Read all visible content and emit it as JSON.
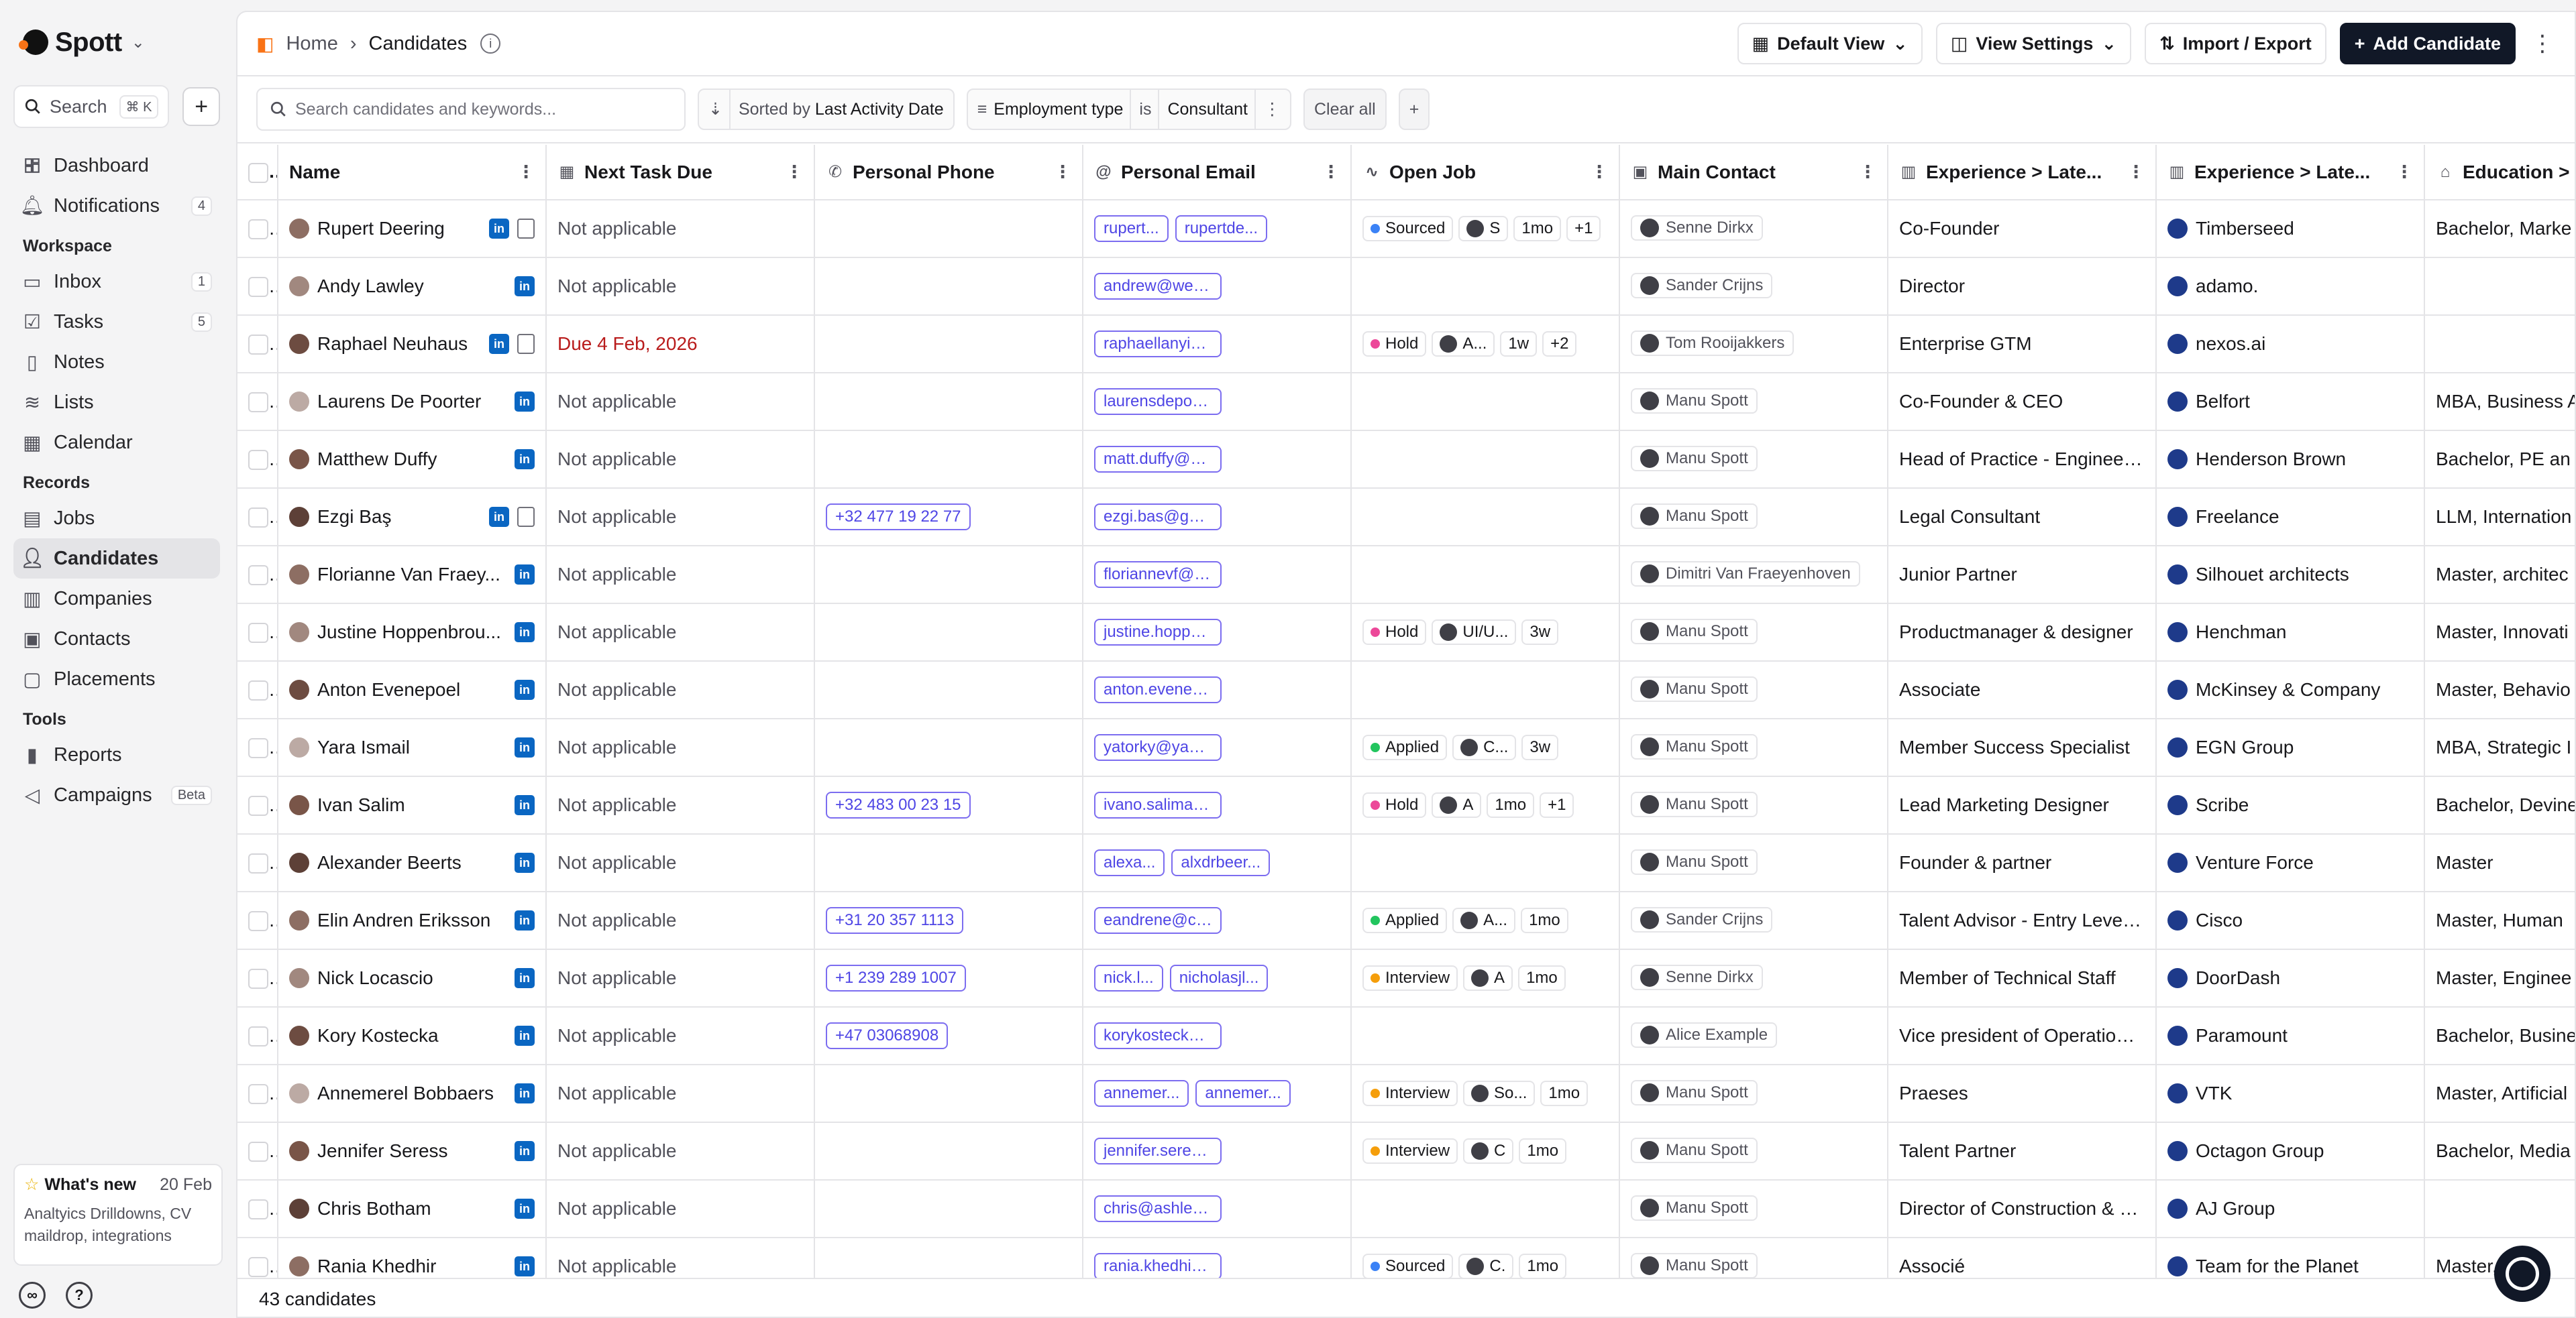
{
  "app": {
    "name": "Spott"
  },
  "sidebar": {
    "search_label": "Search",
    "search_shortcut": "⌘ K",
    "top_items": [
      {
        "label": "Dashboard",
        "icon": "dashboard-icon"
      },
      {
        "label": "Notifications",
        "icon": "bell-icon",
        "count": "4"
      }
    ],
    "workspace_title": "Workspace",
    "workspace_items": [
      {
        "label": "Inbox",
        "icon": "inbox-icon",
        "count": "1"
      },
      {
        "label": "Tasks",
        "icon": "tasks-icon",
        "count": "5"
      },
      {
        "label": "Notes",
        "icon": "notes-icon"
      },
      {
        "label": "Lists",
        "icon": "lists-icon"
      },
      {
        "label": "Calendar",
        "icon": "calendar-icon"
      }
    ],
    "records_title": "Records",
    "records_items": [
      {
        "label": "Jobs",
        "icon": "jobs-icon"
      },
      {
        "label": "Candidates",
        "icon": "user-icon",
        "active": true
      },
      {
        "label": "Companies",
        "icon": "building-icon"
      },
      {
        "label": "Contacts",
        "icon": "contacts-icon"
      },
      {
        "label": "Placements",
        "icon": "placements-icon"
      }
    ],
    "tools_title": "Tools",
    "tools_items": [
      {
        "label": "Reports",
        "icon": "reports-icon"
      },
      {
        "label": "Campaigns",
        "icon": "megaphone-icon",
        "badge": "Beta"
      }
    ],
    "whats_new": {
      "title": "What's new",
      "date": "20 Feb",
      "body": "Analtyics Drilldowns, CV maildrop, integrations"
    }
  },
  "topbar": {
    "home": "Home",
    "current": "Candidates",
    "default_view": "Default View",
    "view_settings": "View Settings",
    "import_export": "Import / Export",
    "add_candidate": "Add Candidate"
  },
  "filters": {
    "search_placeholder": "Search candidates and keywords...",
    "sort_prefix": "Sorted by",
    "sort_value": "Last Activity Date",
    "filter_field": "Employment type",
    "filter_op": "is",
    "filter_value": "Consultant",
    "clear_all": "Clear all"
  },
  "table": {
    "columns": [
      {
        "label": "Name",
        "icon": "text-icon"
      },
      {
        "label": "Next Task Due",
        "icon": "calendar-icon"
      },
      {
        "label": "Personal Phone",
        "icon": "phone-icon"
      },
      {
        "label": "Personal Email",
        "icon": "at-icon"
      },
      {
        "label": "Open Job",
        "icon": "activity-icon"
      },
      {
        "label": "Main Contact",
        "icon": "contact-icon"
      },
      {
        "label": "Experience > Late...",
        "icon": "building-icon"
      },
      {
        "label": "Experience > Late...",
        "icon": "building-icon"
      },
      {
        "label": "Education >",
        "icon": "graduation-icon"
      }
    ],
    "rows": [
      {
        "name": "Rupert Deering",
        "cv": true,
        "task": "Not applicable",
        "phone": "",
        "emails": [
          "rupert...",
          "rupertde..."
        ],
        "job": {
          "status": "Sourced",
          "color": "#3b82f6",
          "company": "S",
          "time": "1mo",
          "extra": "+1"
        },
        "contact": "Senne Dirkx",
        "title": "Co-Founder",
        "company": "Timberseed",
        "education": "Bachelor, Marke"
      },
      {
        "name": "Andy Lawley",
        "cv": false,
        "task": "Not applicable",
        "phone": "",
        "emails": [
          "andrew@weareadamo.com"
        ],
        "job": null,
        "contact": "Sander Crijns",
        "title": "Director",
        "company": "adamo.",
        "education": ""
      },
      {
        "name": "Raphael Neuhaus",
        "cv": true,
        "task": "Due 4 Feb, 2026",
        "task_due": true,
        "phone": "",
        "emails": [
          "raphaellanyi@gmail.com"
        ],
        "job": {
          "status": "Hold",
          "color": "#ec4899",
          "company": "A...",
          "time": "1w",
          "extra": "+2"
        },
        "contact": "Tom Rooijakkers",
        "title": "Enterprise GTM",
        "company": "nexos.ai",
        "education": ""
      },
      {
        "name": "Laurens De Poorter",
        "cv": false,
        "task": "Not applicable",
        "phone": "",
        "emails": [
          "laurensdepoorter@gmail.com"
        ],
        "job": null,
        "contact": "Manu Spott",
        "title": "Co-Founder & CEO",
        "company": "Belfort",
        "education": "MBA, Business A"
      },
      {
        "name": "Matthew Duffy",
        "cv": false,
        "task": "Not applicable",
        "phone": "",
        "emails": [
          "matt.duffy@hendbrown.com"
        ],
        "job": null,
        "contact": "Manu Spott",
        "title": "Head of Practice - Engineeri...",
        "company": "Henderson Brown",
        "education": "Bachelor, PE an"
      },
      {
        "name": "Ezgi Baş",
        "cv": true,
        "task": "Not applicable",
        "phone": "+32 477 19 22 77",
        "emails": [
          "ezgi.bas@gmail.com"
        ],
        "job": null,
        "contact": "Manu Spott",
        "title": "Legal Consultant",
        "company": "Freelance",
        "education": "LLM, Internation"
      },
      {
        "name": "Florianne Van Fraey...",
        "cv": false,
        "task": "Not applicable",
        "phone": "",
        "emails": [
          "floriannevf@hotmail.com"
        ],
        "job": null,
        "contact": "Dimitri Van Fraeyenhoven",
        "title": "Junior Partner",
        "company": "Silhouet architects",
        "education": "Master, architec"
      },
      {
        "name": "Justine Hoppenbrou...",
        "cv": false,
        "task": "Not applicable",
        "phone": "",
        "emails": [
          "justine.hoppenbrouwers@g..."
        ],
        "job": {
          "status": "Hold",
          "color": "#ec4899",
          "company": "UI/U...",
          "time": "3w",
          "extra": ""
        },
        "contact": "Manu Spott",
        "title": "Productmanager & designer",
        "company": "Henchman",
        "education": "Master, Innovati"
      },
      {
        "name": "Anton Evenepoel",
        "cv": false,
        "task": "Not applicable",
        "phone": "",
        "emails": [
          "anton.evenepoel@icloud.com"
        ],
        "job": null,
        "contact": "Manu Spott",
        "title": "Associate",
        "company": "McKinsey & Company",
        "education": "Master, Behavio"
      },
      {
        "name": "Yara Ismail",
        "cv": false,
        "task": "Not applicable",
        "phone": "",
        "emails": [
          "yatorky@yahoo.com"
        ],
        "job": {
          "status": "Applied",
          "color": "#22c55e",
          "company": "C...",
          "time": "3w",
          "extra": ""
        },
        "contact": "Manu Spott",
        "title": "Member Success Specialist",
        "company": "EGN Group",
        "education": "MBA, Strategic I"
      },
      {
        "name": "Ivan Salim",
        "cv": false,
        "task": "Not applicable",
        "phone": "+32 483 00 23 15",
        "emails": [
          "ivano.salima@gmail.com"
        ],
        "job": {
          "status": "Hold",
          "color": "#ec4899",
          "company": "A",
          "time": "1mo",
          "extra": "+1"
        },
        "contact": "Manu Spott",
        "title": "Lead Marketing Designer",
        "company": "Scribe",
        "education": "Bachelor, Devine"
      },
      {
        "name": "Alexander Beerts",
        "cv": false,
        "task": "Not applicable",
        "phone": "",
        "emails": [
          "alexa...",
          "alxdrbeer..."
        ],
        "job": null,
        "contact": "Manu Spott",
        "title": "Founder & partner",
        "company": "Venture Force",
        "education": "Master"
      },
      {
        "name": "Elin Andren Eriksson",
        "cv": false,
        "task": "Not applicable",
        "phone": "+31 20 357 1113",
        "emails": [
          "eandrene@cisco.com"
        ],
        "job": {
          "status": "Applied",
          "color": "#22c55e",
          "company": "A...",
          "time": "1mo",
          "extra": ""
        },
        "contact": "Sander Crijns",
        "title": "Talent Advisor - Entry Level ...",
        "company": "Cisco",
        "education": "Master, Human"
      },
      {
        "name": "Nick Locascio",
        "cv": false,
        "task": "Not applicable",
        "phone": "+1 239 289 1007",
        "emails": [
          "nick.l...",
          "nicholasjl..."
        ],
        "job": {
          "status": "Interview",
          "color": "#f59e0b",
          "company": "A",
          "time": "1mo",
          "extra": ""
        },
        "contact": "Senne Dirkx",
        "title": "Member of Technical Staff",
        "company": "DoorDash",
        "education": "Master, Enginee"
      },
      {
        "name": "Kory Kostecka",
        "cv": false,
        "task": "Not applicable",
        "phone": "+47 03068908",
        "emails": [
          "korykostecka@yahoo.com"
        ],
        "job": null,
        "contact": "Alice Example",
        "title": "Vice president of Operations...",
        "company": "Paramount",
        "education": "Bachelor, Busine"
      },
      {
        "name": "Annemerel Bobbaers",
        "cv": false,
        "task": "Not applicable",
        "phone": "",
        "emails": [
          "annemer...",
          "annemer..."
        ],
        "job": {
          "status": "Interview",
          "color": "#f59e0b",
          "company": "So...",
          "time": "1mo",
          "extra": ""
        },
        "contact": "Manu Spott",
        "title": "Praeses",
        "company": "VTK",
        "education": "Master, Artificial"
      },
      {
        "name": "Jennifer Seress",
        "cv": false,
        "task": "Not applicable",
        "phone": "",
        "emails": [
          "jennifer.seress@gmail.com"
        ],
        "job": {
          "status": "Interview",
          "color": "#f59e0b",
          "company": "C",
          "time": "1mo",
          "extra": ""
        },
        "contact": "Manu Spott",
        "title": "Talent Partner",
        "company": "Octagon Group",
        "education": "Bachelor, Media"
      },
      {
        "name": "Chris Botham",
        "cv": false,
        "task": "Not applicable",
        "phone": "",
        "emails": [
          "chris@ashleyjamesgroup.com"
        ],
        "job": null,
        "contact": "Manu Spott",
        "title": "Director of Construction & E...",
        "company": "AJ Group",
        "education": ""
      },
      {
        "name": "Rania Khedhir",
        "cv": false,
        "task": "Not applicable",
        "phone": "",
        "emails": [
          "rania.khedhir@palicao.com"
        ],
        "job": {
          "status": "Sourced",
          "color": "#3b82f6",
          "company": "C.",
          "time": "1mo",
          "extra": ""
        },
        "contact": "Manu Spott",
        "title": "Associé",
        "company": "Team for the Planet",
        "education": "Master, Ingé"
      }
    ]
  },
  "footer": {
    "count": "43 candidates"
  },
  "colors": {
    "accent": "#4f46e5",
    "primary_button": "#111827",
    "linkedin": "#0a66c2",
    "due": "#b91c1c"
  }
}
